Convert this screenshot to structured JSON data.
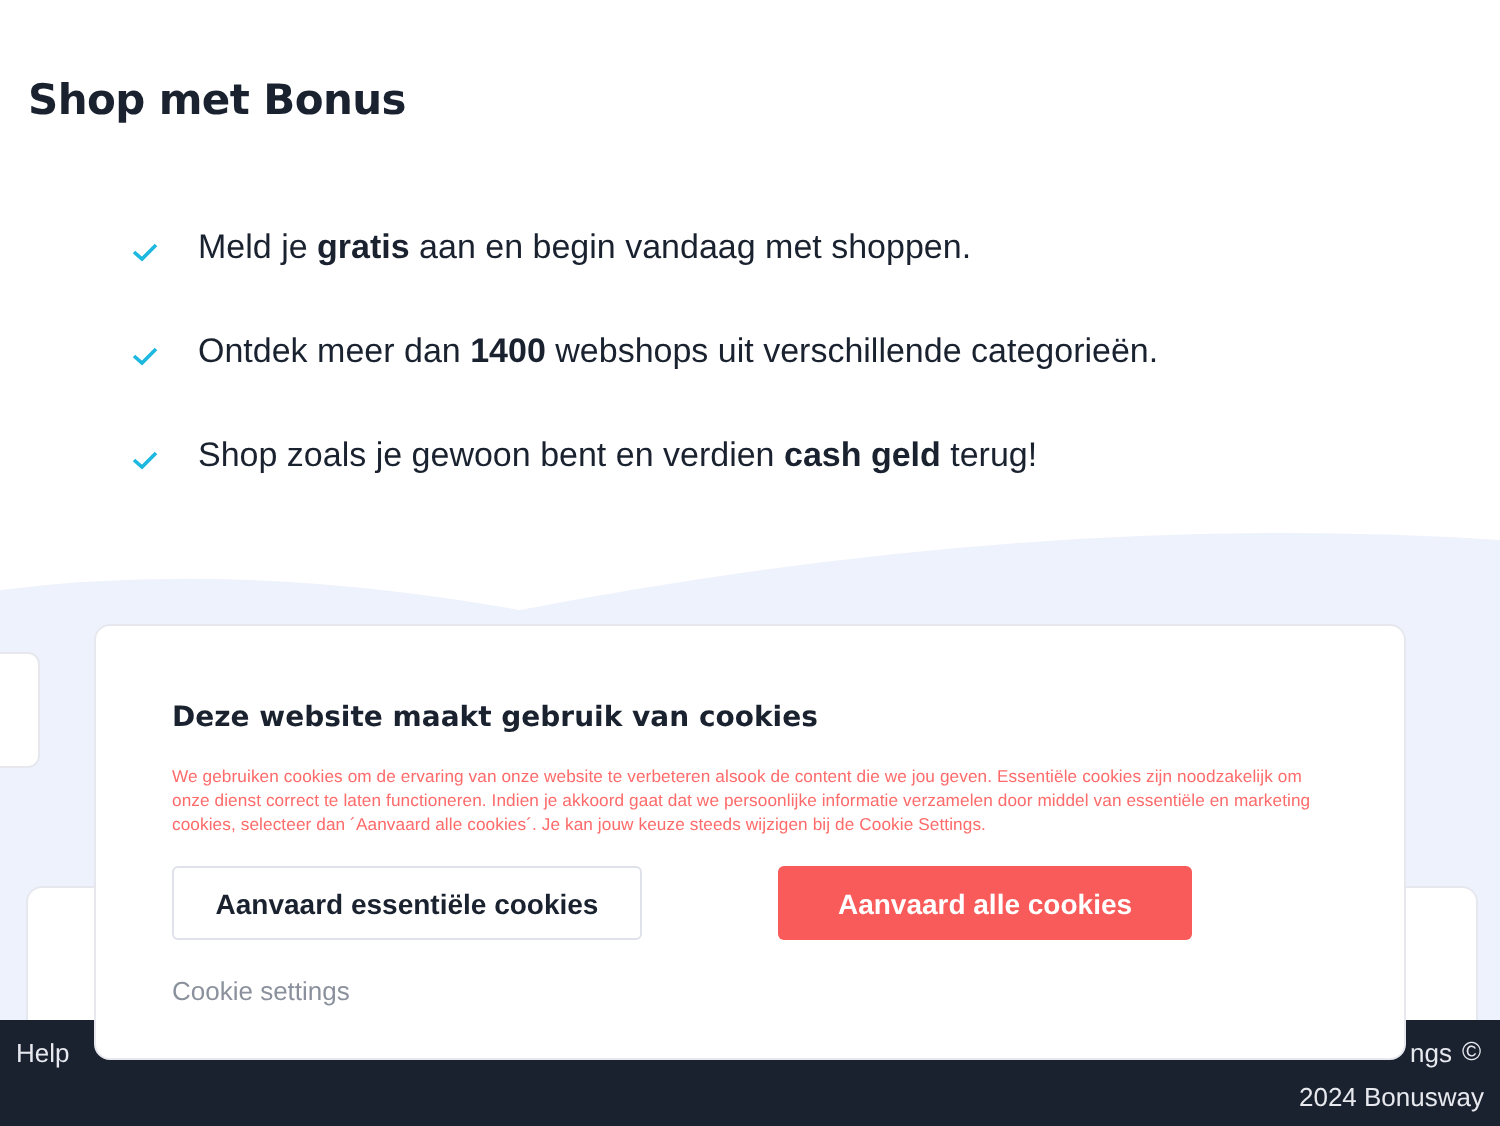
{
  "page_title": "Shop met Bonus",
  "benefits": [
    {
      "text": "Meld je **gratis** aan en begin vandaag met shoppen."
    },
    {
      "text": "Ontdek meer dan **1400** webshops uit verschillende categorieën."
    },
    {
      "text": "Shop zoals je gewoon bent en verdien **cash geld** terug!"
    }
  ],
  "footer": {
    "links": [
      "Help",
      "ngs"
    ],
    "copyright": "©",
    "year_line": "2024 Bonusway"
  },
  "cookie_dialog": {
    "title": "Deze website maakt gebruik van cookies",
    "body": "We gebruiken cookies om de ervaring van onze website te verbeteren alsook de content die we jou geven. Essentiële cookies zijn noodzakelijk om onze dienst correct te laten functioneren. Indien je akkoord gaat dat we persoonlijke informatie verzamelen door middel van essentiële en marketing cookies, selecteer dan ´Aanvaard alle cookies´. Je kan jouw keuze steeds wijzigen bij de Cookie Settings.",
    "buttons": [
      {
        "label": "Aanvaard essentiële cookies",
        "kind": "secondary"
      },
      {
        "label": "Aanvaard alle cookies",
        "kind": "primary"
      }
    ],
    "settings_link": "Cookie settings"
  }
}
